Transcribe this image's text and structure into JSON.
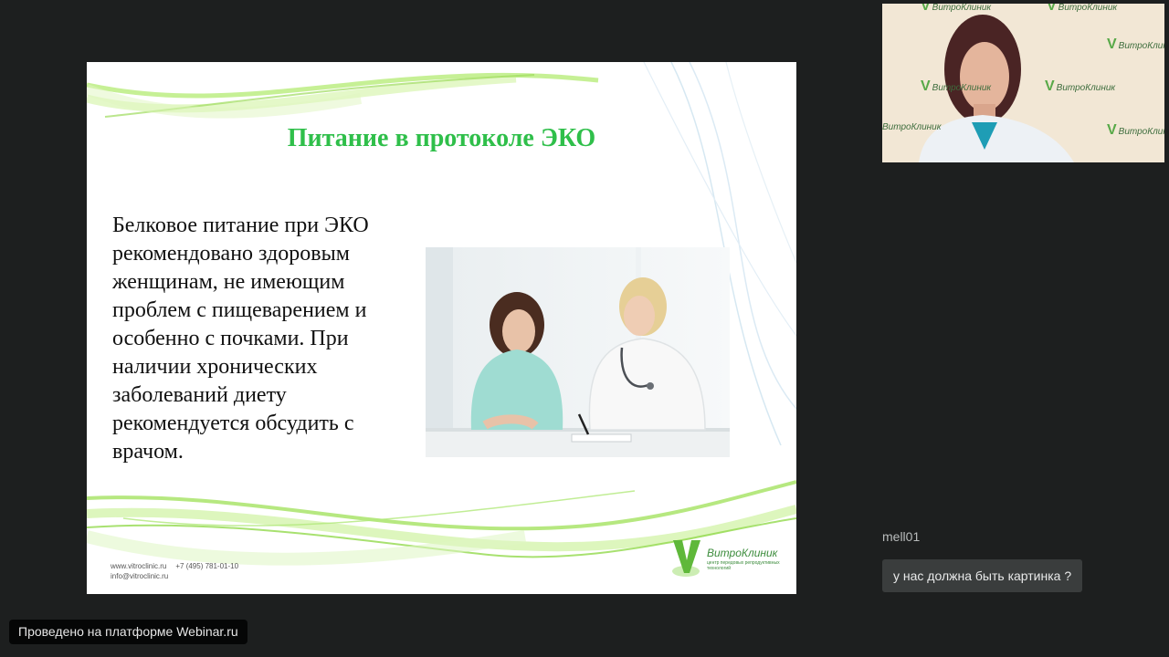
{
  "slide": {
    "title": "Питание в протоколе ЭКО",
    "body_lines": [
      "Белковое питание при ЭКО",
      "рекомендовано здоровым",
      "женщинам, не имеющим",
      "проблем с пищеварением и",
      "особенно с почками. При",
      "наличии хронических",
      "заболеваний диету",
      "рекомендуется обсудить с",
      "врачом."
    ],
    "photo_icon": "doctor-patient-photo",
    "footer": {
      "website": "www.vitroclinic.ru",
      "phone": "+7 (495) 781-01-10",
      "email": "info@vitroclinic.ru"
    },
    "logo": {
      "letter": "V",
      "name": "ВитроКлиник",
      "subtitle": "центр передовых репродуктивных технологий"
    },
    "colors": {
      "title": "#2fbf4a",
      "swoosh": "#8fd94a"
    }
  },
  "webcam": {
    "backdrop_logo_letter": "V",
    "backdrop_logo_text": "ВитроКлиник"
  },
  "chat": {
    "username": "mell01",
    "message": "у нас должна быть картинка ?"
  },
  "platform_badge": "Проведено на платформе Webinar.ru"
}
